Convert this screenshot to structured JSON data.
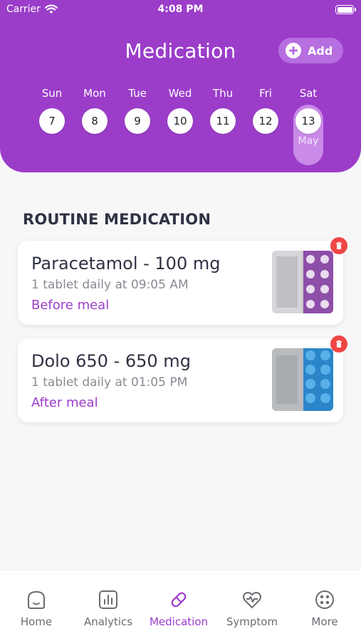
{
  "status_bar": {
    "carrier": "Carrier",
    "time": "4:08 PM"
  },
  "header": {
    "title": "Medication",
    "add_label": "Add"
  },
  "week": {
    "days": [
      {
        "name": "Sun",
        "date": "7"
      },
      {
        "name": "Mon",
        "date": "8"
      },
      {
        "name": "Tue",
        "date": "9"
      },
      {
        "name": "Wed",
        "date": "10"
      },
      {
        "name": "Thu",
        "date": "11"
      },
      {
        "name": "Fri",
        "date": "12"
      },
      {
        "name": "Sat",
        "date": "13",
        "month": "May",
        "selected": true
      }
    ]
  },
  "section": {
    "title": "ROUTINE MEDICATION"
  },
  "medications": [
    {
      "name": "Paracetamol - 100 mg",
      "schedule": "1 tablet daily at 09:05 AM",
      "timing": "Before meal",
      "image_icon": "purple-pill-strip"
    },
    {
      "name": "Dolo 650 - 650 mg",
      "schedule": "1 tablet daily at 01:05 PM",
      "timing": "After meal",
      "image_icon": "blue-pill-strip"
    }
  ],
  "tabs": [
    {
      "label": "Home",
      "icon": "home-icon"
    },
    {
      "label": "Analytics",
      "icon": "analytics-icon"
    },
    {
      "label": "Medication",
      "icon": "pill-icon",
      "active": true
    },
    {
      "label": "Symptom",
      "icon": "heartbeat-icon"
    },
    {
      "label": "More",
      "icon": "more-grid-icon"
    }
  ],
  "colors": {
    "brand": "#9b3dc9",
    "delete": "#f04545",
    "accent_light": "#b66ee0"
  }
}
